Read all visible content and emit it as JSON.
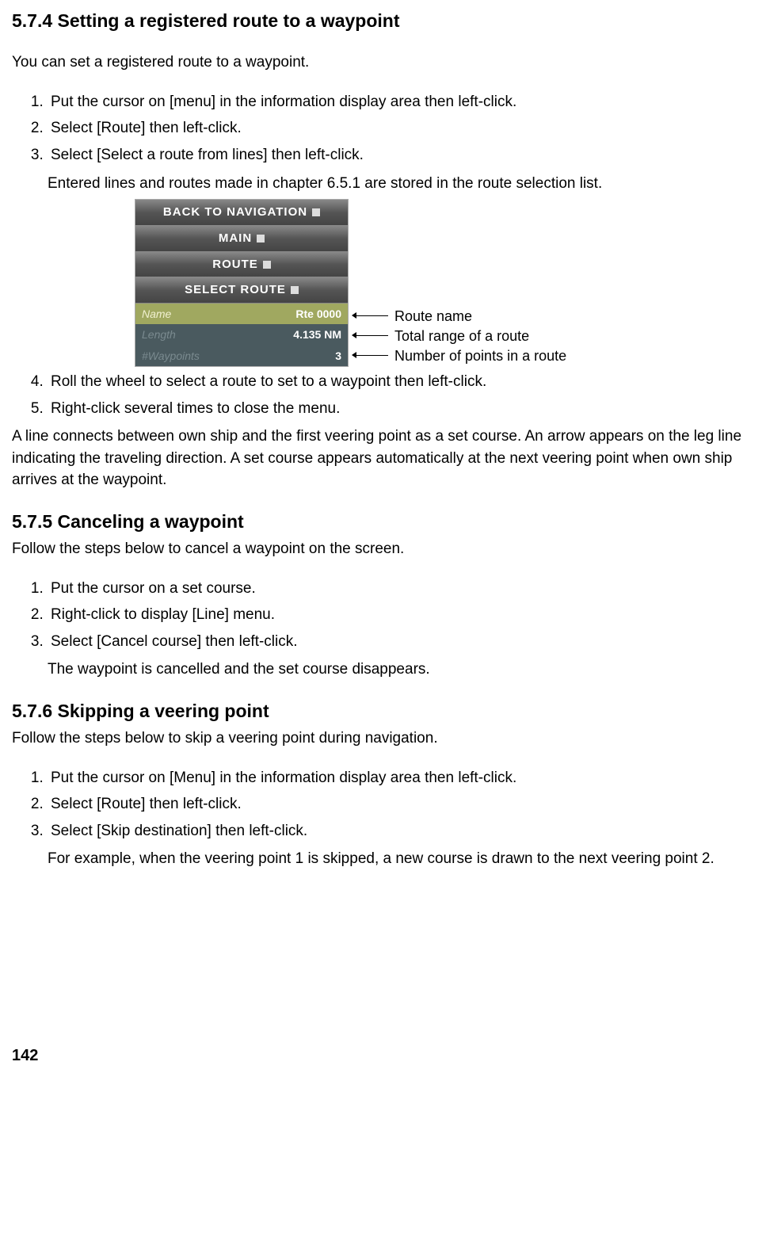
{
  "section574": {
    "heading": "5.7.4 Setting a registered route to a waypoint",
    "intro": "You can set a registered route to a waypoint.",
    "steps": [
      "Put the cursor on [menu] in the information display area then left-click.",
      "Select [Route] then left-click.",
      "Select [Select a route from lines] then left-click."
    ],
    "step3_sub": "Entered lines and routes made in chapter 6.5.1 are stored in the route selection list.",
    "menu": {
      "row1": "BACK TO NAVIGATION",
      "row2": "MAIN",
      "row3": "ROUTE",
      "row4": "SELECT ROUTE",
      "info": [
        {
          "label": "Name",
          "value": "Rte 0000"
        },
        {
          "label": "Length",
          "value": "4.135 NM"
        },
        {
          "label": "#Waypoints",
          "value": "3"
        }
      ]
    },
    "annotations": [
      "Route name",
      "Total range of a route",
      "Number of points in a route"
    ],
    "steps_cont": [
      "Roll the wheel to select a route to set to a waypoint then left-click.",
      "Right-click several times to close the menu."
    ],
    "post_para": "A line connects between own ship and the first veering point as a set course. An arrow appears on the leg line indicating the traveling direction.  A set course appears automatically at the next veering point when own ship arrives at the waypoint."
  },
  "section575": {
    "heading": "5.7.5 Canceling a waypoint",
    "intro": "Follow the steps below to cancel a waypoint on the screen.",
    "steps": [
      "Put the cursor on a set course.",
      "Right-click to display [Line] menu.",
      "Select [Cancel course] then left-click."
    ],
    "step3_sub": "The waypoint is cancelled and the set course disappears."
  },
  "section576": {
    "heading": "5.7.6 Skipping a veering point",
    "intro": "Follow the steps below to skip a veering point during navigation.",
    "steps": [
      "Put the cursor on [Menu] in the information display area then left-click.",
      "Select [Route] then left-click.",
      "Select [Skip destination] then left-click."
    ],
    "step3_sub": "For example, when the veering point 1 is skipped, a new course is drawn to the next veering point 2."
  },
  "page_num": "142"
}
